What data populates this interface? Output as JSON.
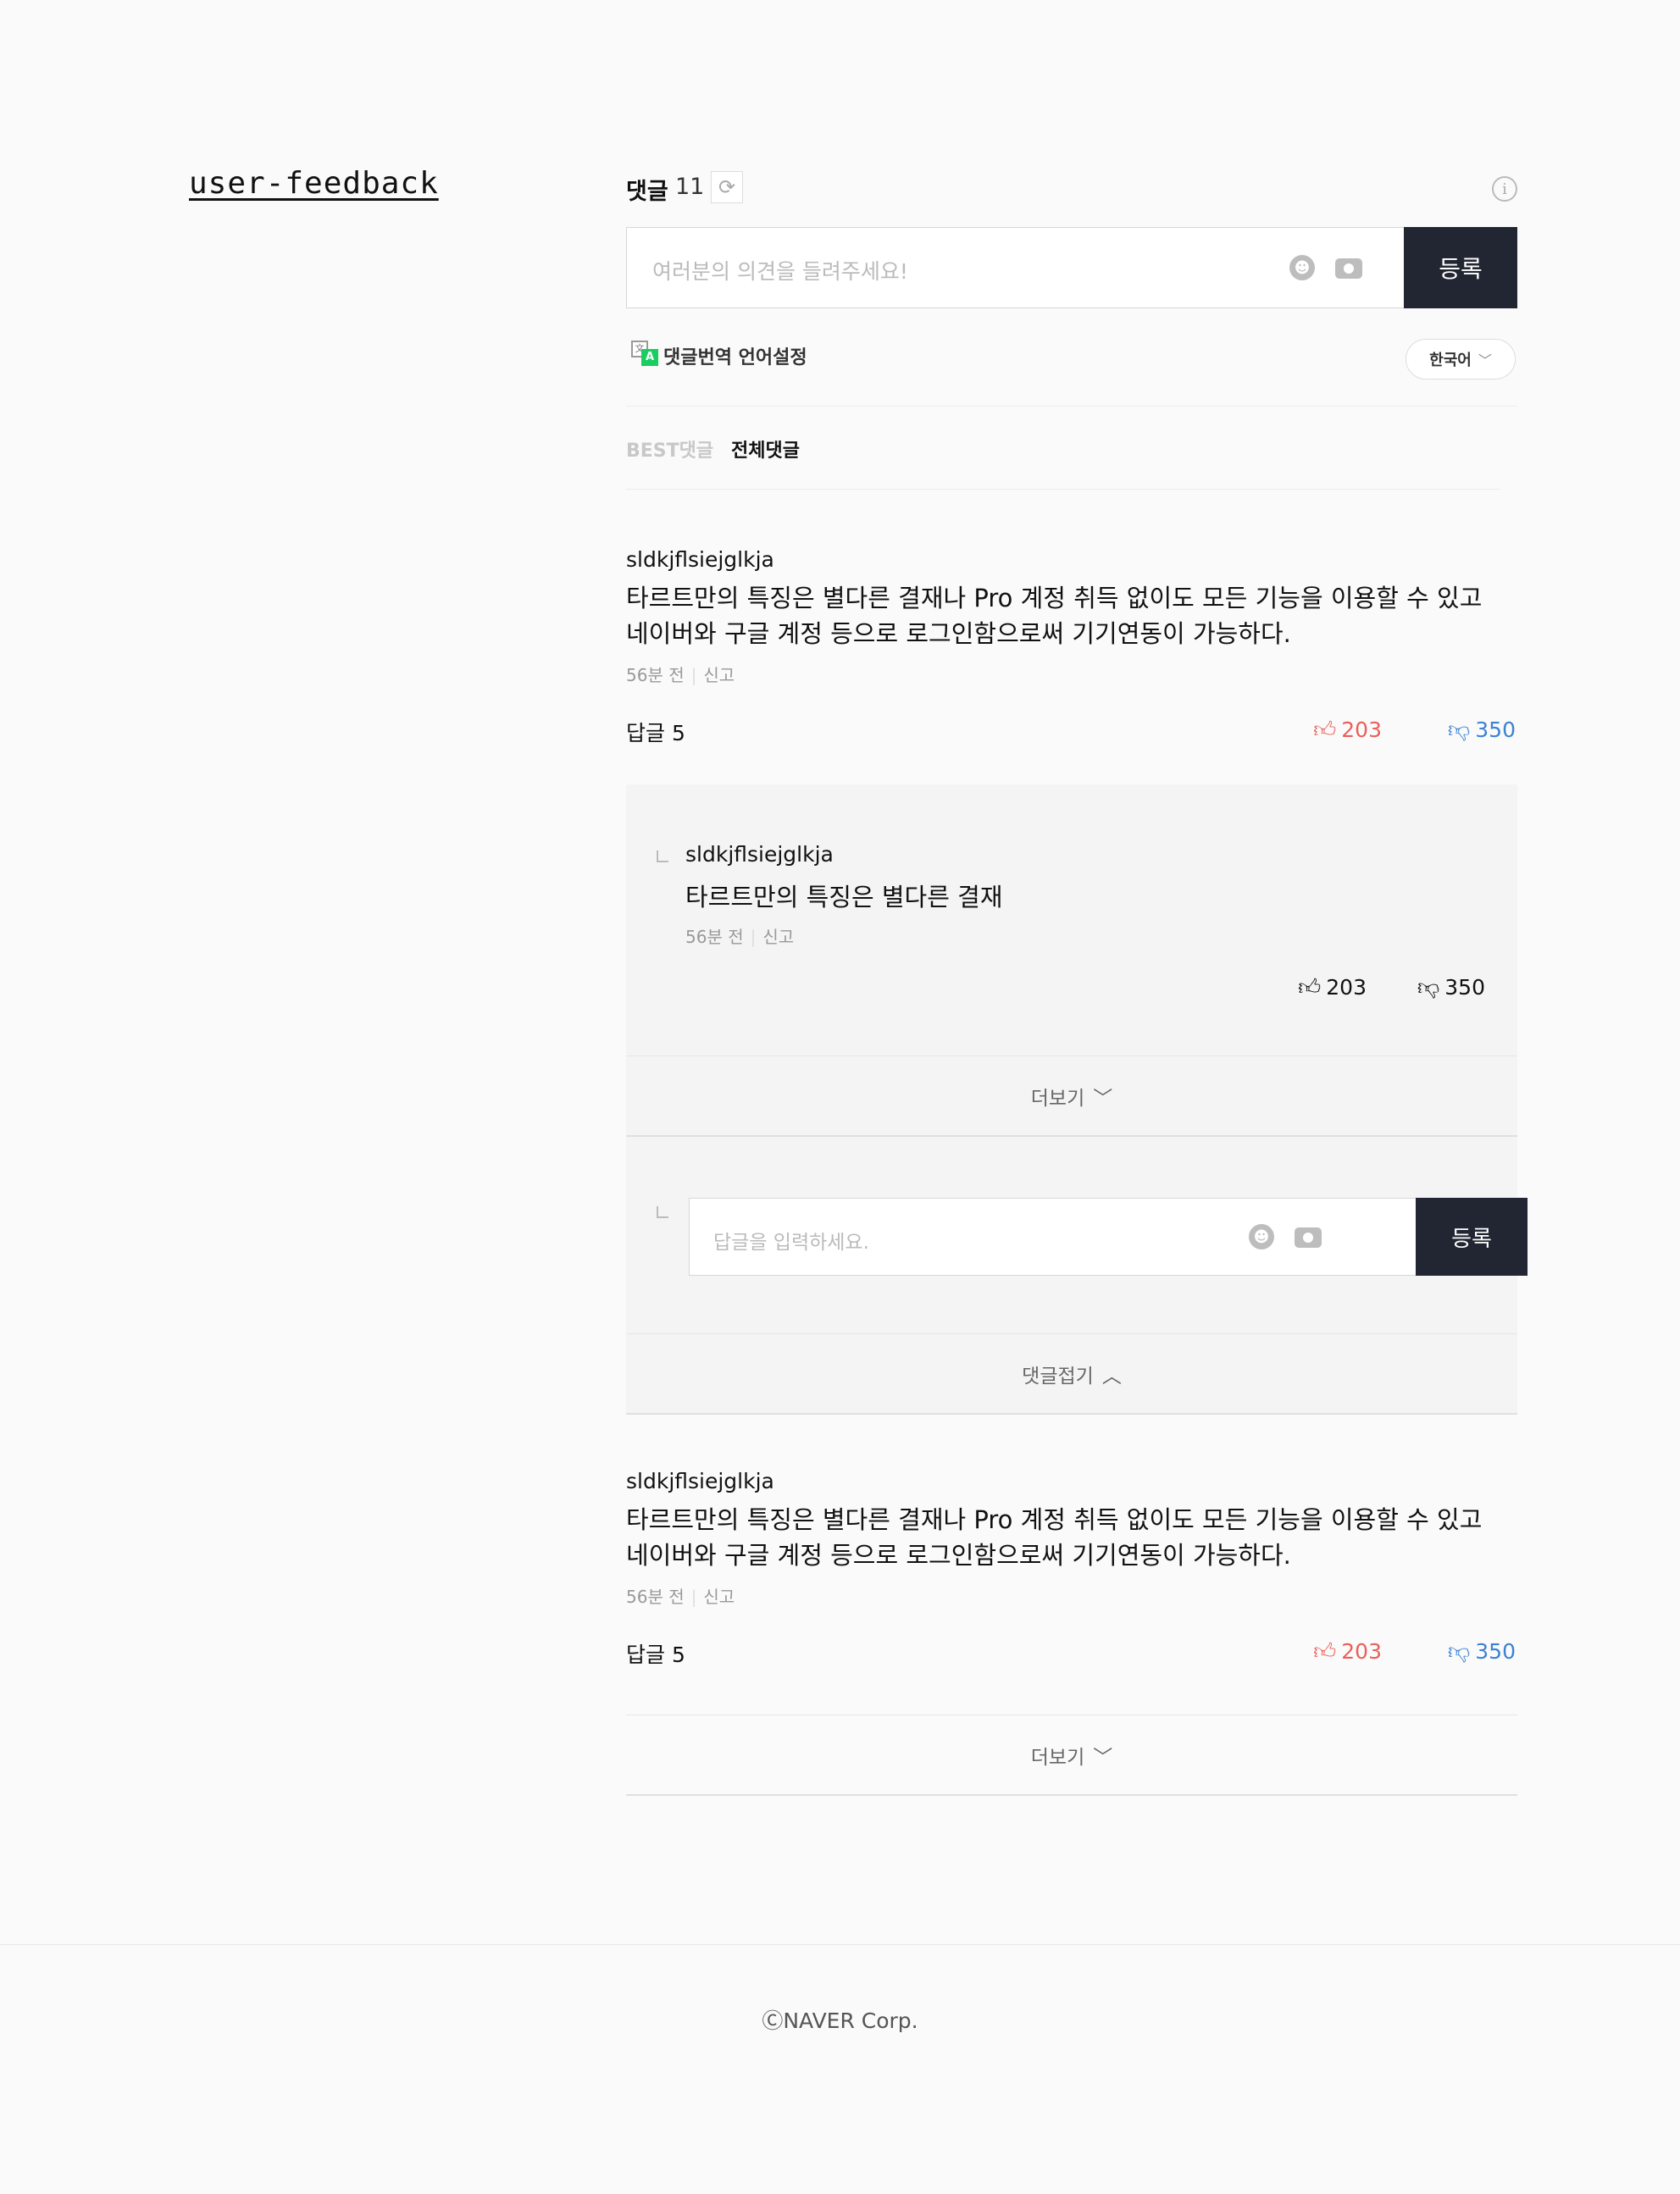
{
  "brand": "user-feedback",
  "header": {
    "title": "댓글",
    "count": "11"
  },
  "composer": {
    "placeholder": "여러분의 의견을 들려주세요!",
    "submit_label": "등록"
  },
  "translation": {
    "label": "댓글번역 언어설정",
    "language": "한국어"
  },
  "tabs": {
    "best": "BEST댓글",
    "all": "전체댓글"
  },
  "comments": [
    {
      "author": "sldkjflsiejglkja",
      "line1": "타르트만의 특징은 별다른 결재나 Pro 계정 취득 없이도 모든 기능을 이용할 수 있고",
      "line2": "네이버와 구글 계정 등으로 로그인함으로써 기기연동이 가능하다.",
      "time": "56분 전",
      "report": "신고",
      "replies_label": "답글 5",
      "likes": "203",
      "dislikes": "350"
    },
    {
      "author": "sldkjflsiejglkja",
      "line1": "타르트만의 특징은 별다른 결재나 Pro 계정 취득 없이도 모든 기능을 이용할 수 있고",
      "line2": "네이버와 구글 계정 등으로 로그인함으로써 기기연동이 가능하다.",
      "time": "56분 전",
      "report": "신고",
      "replies_label": "답글 5",
      "likes": "203",
      "dislikes": "350"
    }
  ],
  "reply": {
    "author": "sldkjflsiejglkja",
    "text": "타르트만의 특징은 별다른 결재",
    "time": "56분 전",
    "report": "신고",
    "likes": "203",
    "dislikes": "350"
  },
  "more_label": "더보기",
  "reply_composer": {
    "placeholder": "답글을 입력하세요.",
    "submit_label": "등록"
  },
  "collapse_label": "댓글접기",
  "footer": "ⒸNAVER Corp.",
  "colors": {
    "like": "#e9605b",
    "dislike": "#3c82d4",
    "button": "#222632"
  }
}
